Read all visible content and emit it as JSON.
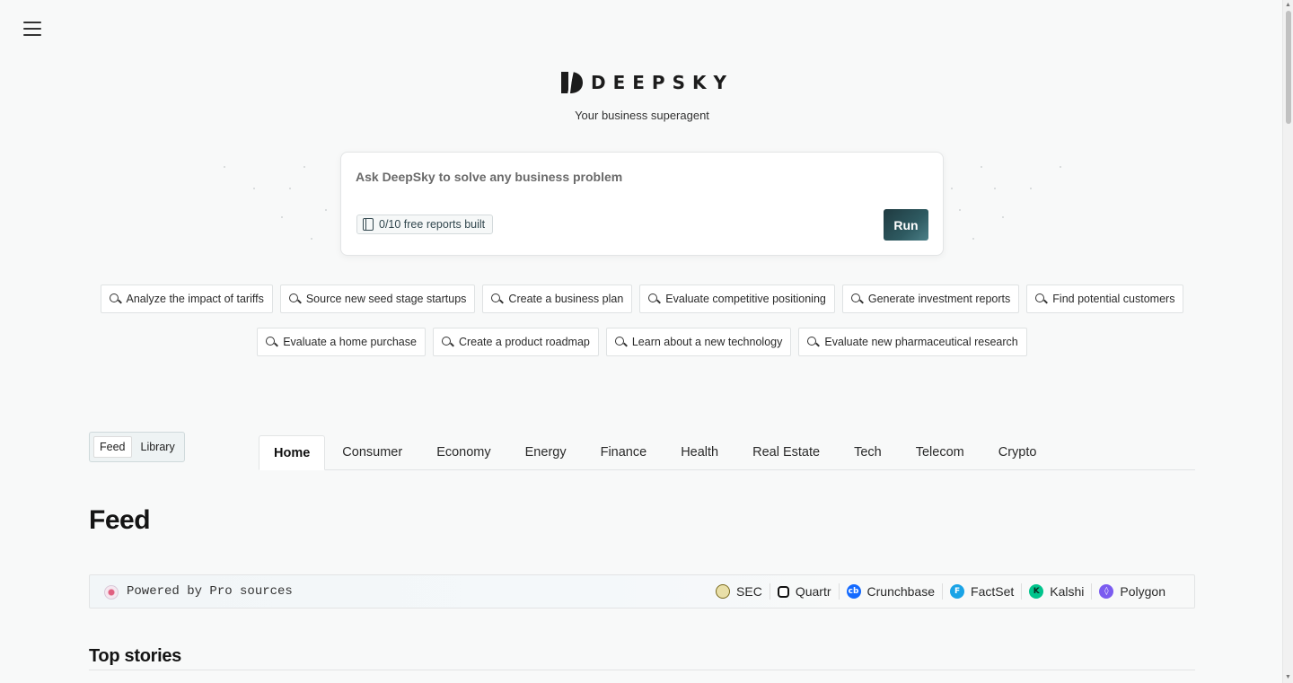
{
  "header": {
    "brand": "DEEPSKY",
    "tagline": "Your business superagent"
  },
  "prompt": {
    "placeholder": "Ask DeepSky to solve any business problem",
    "reports_label": "0/10 free reports built",
    "run_label": "Run"
  },
  "suggestions": {
    "row1": [
      "Analyze the impact of tariffs",
      "Source new seed stage startups",
      "Create a business plan",
      "Evaluate competitive positioning",
      "Generate investment reports",
      "Find potential customers"
    ],
    "row2": [
      "Evaluate a home purchase",
      "Create a product roadmap",
      "Learn about a new technology",
      "Evaluate new pharmaceutical research"
    ]
  },
  "view_toggle": {
    "feed": "Feed",
    "library": "Library",
    "selected": "Feed"
  },
  "tabs": [
    "Home",
    "Consumer",
    "Economy",
    "Energy",
    "Finance",
    "Health",
    "Real Estate",
    "Tech",
    "Telecom",
    "Crypto"
  ],
  "active_tab": "Home",
  "main": {
    "title": "Feed",
    "powered_by": "Powered by Pro sources",
    "sources": [
      {
        "name": "SEC",
        "icon": "sec-seal-icon",
        "color": "#7a6a1e"
      },
      {
        "name": "Quartr",
        "icon": "quartr-icon",
        "color": "#111111"
      },
      {
        "name": "Crunchbase",
        "icon": "crunchbase-icon",
        "color": "#146aff"
      },
      {
        "name": "FactSet",
        "icon": "factset-icon",
        "color": "#1aa3e6"
      },
      {
        "name": "Kalshi",
        "icon": "kalshi-icon",
        "color": "#00c48c"
      },
      {
        "name": "Polygon",
        "icon": "polygon-icon",
        "color": "#7b5cf0"
      }
    ],
    "section_title": "Top stories"
  }
}
